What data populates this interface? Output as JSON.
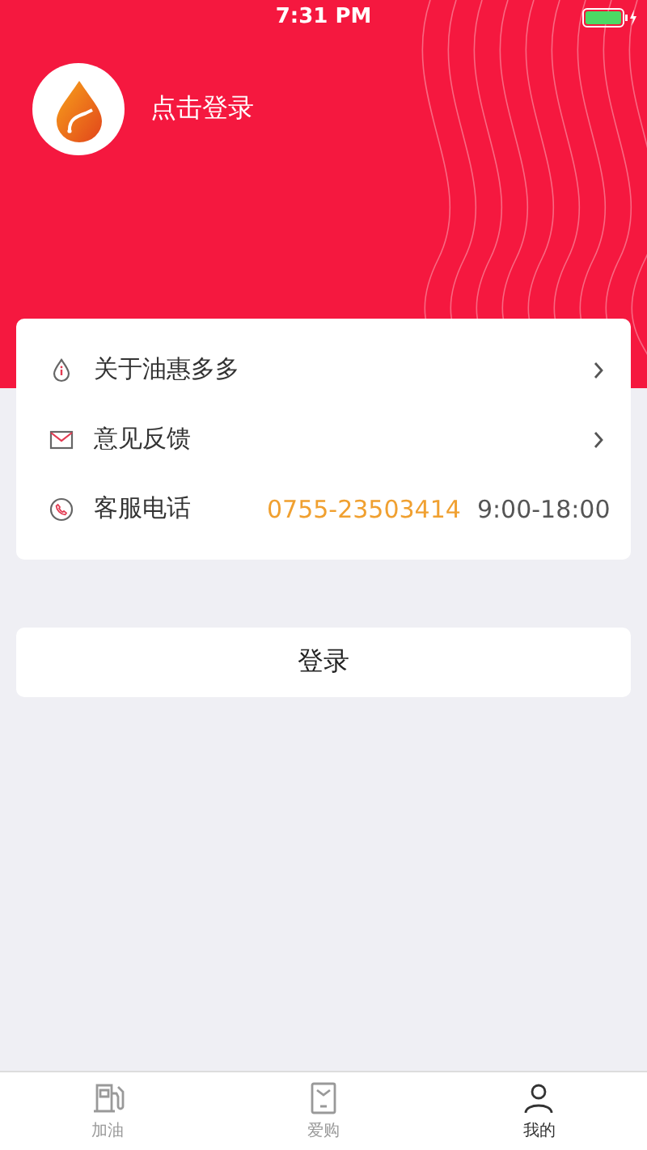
{
  "status_bar": {
    "time": "7:31 PM"
  },
  "header": {
    "login_prompt": "点击登录"
  },
  "menu": [
    {
      "kind": "about",
      "label": "关于油惠多多"
    },
    {
      "kind": "feedback",
      "label": "意见反馈"
    },
    {
      "kind": "phone",
      "label": "客服电话",
      "phone": "0755-23503414",
      "hours": "9:00-18:00"
    }
  ],
  "login_button": "登录",
  "tabs": [
    {
      "kind": "fuel",
      "label": "加油",
      "selected": false
    },
    {
      "kind": "shop",
      "label": "爱购",
      "selected": false
    },
    {
      "kind": "me",
      "label": "我的",
      "selected": true
    }
  ]
}
